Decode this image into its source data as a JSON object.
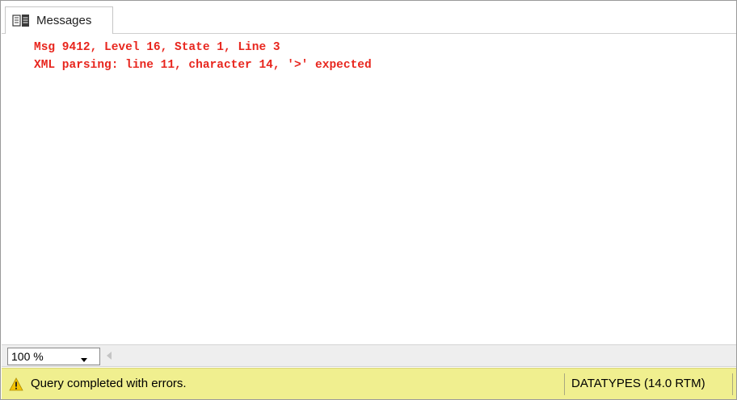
{
  "tab": {
    "label": "Messages",
    "icon": "messages-icon"
  },
  "messages": [
    "Msg 9412, Level 16, State 1, Line 3",
    "XML parsing: line 11, character 14, '>' expected"
  ],
  "zoom": {
    "value": "100 %"
  },
  "status": {
    "icon": "warning-icon",
    "text": "Query completed with errors.",
    "server": "DATATYPES (14.0 RTM)"
  },
  "colors": {
    "error_text": "#e8261e",
    "status_bar": "#f0ef8f",
    "warning": "#f5c400"
  }
}
